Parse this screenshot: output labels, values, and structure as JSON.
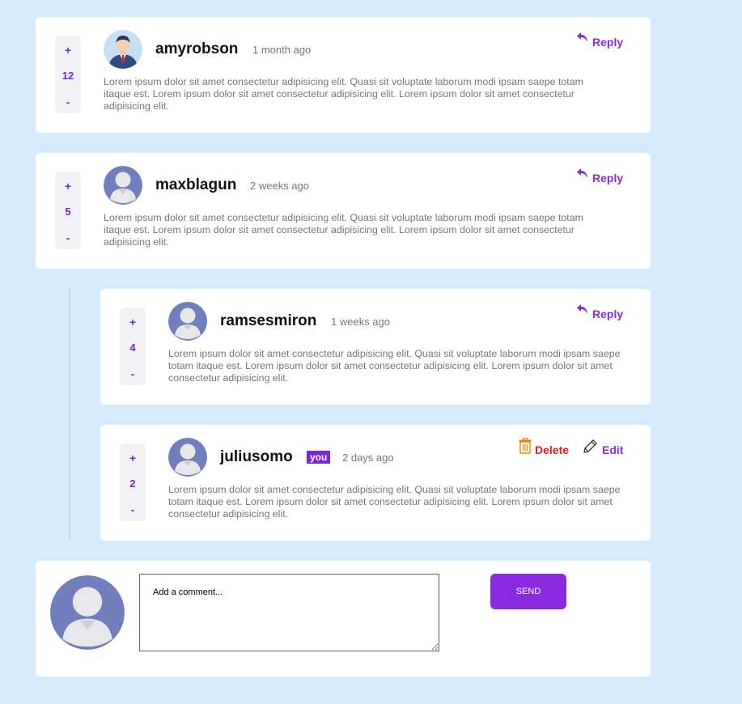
{
  "comments": [
    {
      "username": "amyrobson",
      "time": "1 month ago",
      "score": "12",
      "text": "Lorem ipsum dolor sit amet consectetur adipisicing elit. Quasi sit voluptate laborum modi ipsam saepe totam itaque est. Lorem ipsum dolor sit amet consectetur adipisicing elit. Lorem ipsum dolor sit amet consectetur adipisicing elit.",
      "action": "Reply",
      "avatar": "businessman-avatar-icon"
    },
    {
      "username": "maxblagun",
      "time": "2 weeks ago",
      "score": "5",
      "text": "Lorem ipsum dolor sit amet consectetur adipisicing elit. Quasi sit voluptate laborum modi ipsam saepe totam itaque est. Lorem ipsum dolor sit amet consectetur adipisicing elit. Lorem ipsum dolor sit amet consectetur adipisicing elit.",
      "action": "Reply",
      "avatar": "default-user-avatar-icon"
    }
  ],
  "replies": [
    {
      "username": "ramsesmiron",
      "time": "1 weeks ago",
      "score": "4",
      "text": "Lorem ipsum dolor sit amet consectetur adipisicing elit. Quasi sit voluptate laborum modi ipsam saepe totam itaque est. Lorem ipsum dolor sit amet consectetur adipisicing elit. Lorem ipsum dolor sit amet consectetur adipisicing elit.",
      "action": "Reply",
      "avatar": "default-user-avatar-icon"
    },
    {
      "username": "juliusomo",
      "badge": "you",
      "time": "2 days ago",
      "score": "2",
      "text": "Lorem ipsum dolor sit amet consectetur adipisicing elit. Quasi sit voluptate laborum modi ipsam saepe totam itaque est. Lorem ipsum dolor sit amet consectetur adipisicing elit. Lorem ipsum dolor sit amet consectetur adipisicing elit.",
      "delete_label": "Delete",
      "edit_label": "Edit",
      "avatar": "default-user-avatar-icon"
    }
  ],
  "vote": {
    "plus": "+",
    "minus": "-"
  },
  "new_comment": {
    "placeholder": "Add a comment...",
    "send_label": "SEND",
    "avatar": "default-user-avatar-icon"
  },
  "colors": {
    "background": "#d6ebfb",
    "accent": "#8a2be2",
    "delete": "#e01c1c",
    "avatar_default": "#7180bd"
  }
}
